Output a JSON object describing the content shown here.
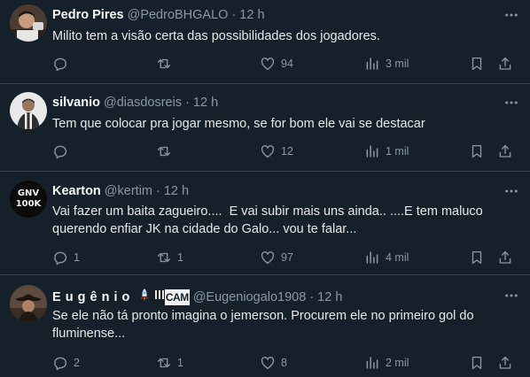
{
  "tweets": [
    {
      "name": "Pedro Pires",
      "handle": "@PedroBHGALO",
      "time": "12 h",
      "text": "Milito tem a visão certa das possibilidades dos jogadores.",
      "replies": "",
      "retweets": "",
      "likes": "94",
      "views": "3 mil"
    },
    {
      "name": "silvanio",
      "handle": "@diasdosreis",
      "time": "12 h",
      "text": "Tem que colocar pra jogar mesmo, se for bom ele vai se destacar",
      "replies": "",
      "retweets": "",
      "likes": "12",
      "views": "1 mil"
    },
    {
      "name": "Kearton",
      "handle": "@kertim",
      "time": "12 h",
      "avatar_text": "GNV 100K",
      "text": "Vai fazer um baita zagueiro....  E vai subir mais uns ainda.. ....E tem maluco querendo enfiar JK na cidade do Galo... vou te falar...",
      "replies": "1",
      "retweets": "1",
      "likes": "97",
      "views": "4 mil"
    },
    {
      "name": "E u g ê n i o",
      "name_suffix": "CAM",
      "handle": "@Eugeniogalo1908",
      "time": "12 h",
      "text": "Se ele não tá pronto imagina o jemerson. Procurem ele no primeiro gol do fluminense...",
      "replies": "2",
      "retweets": "1",
      "likes": "8",
      "views": "2 mil"
    }
  ],
  "dot": "·",
  "colors": {
    "background": "#15202b",
    "text": "#e7e9ea",
    "muted": "#8b98a5",
    "divider": "#38444d"
  },
  "icons": [
    "avatar",
    "more-icon",
    "reply-icon",
    "retweet-icon",
    "like-icon",
    "views-icon",
    "bookmark-icon",
    "share-icon"
  ]
}
